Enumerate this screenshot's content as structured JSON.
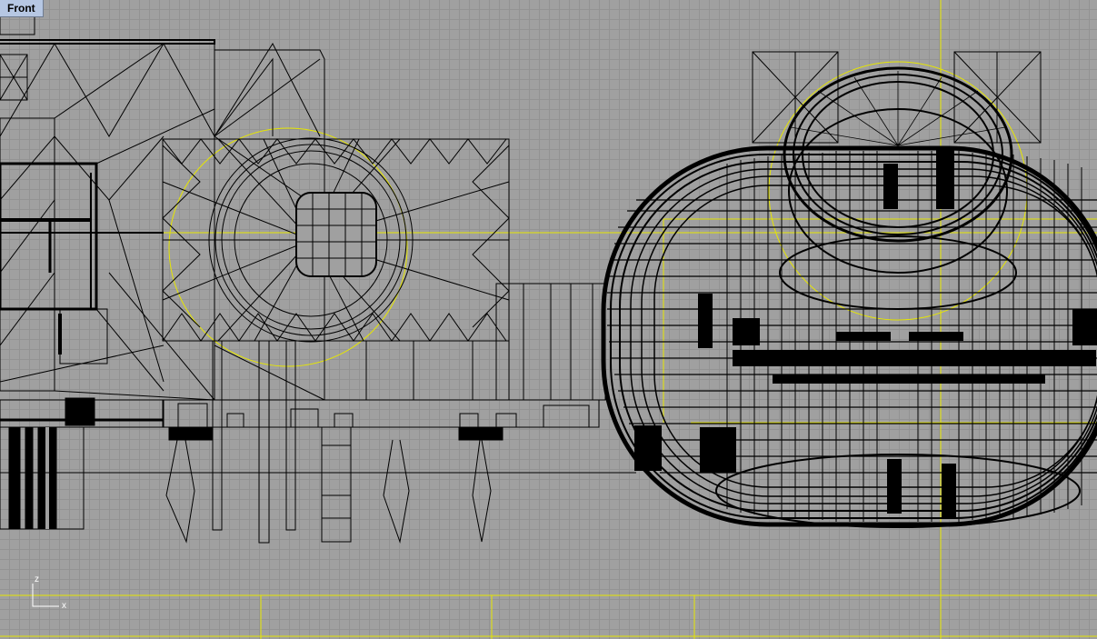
{
  "viewport": {
    "name": "Front",
    "background": "#a0a0a0",
    "grid_color": "#939393",
    "axis_color": "#e6e600",
    "wire_color": "#000000"
  },
  "axis_icon": {
    "vertical_label": "z",
    "horizontal_label": "x"
  }
}
